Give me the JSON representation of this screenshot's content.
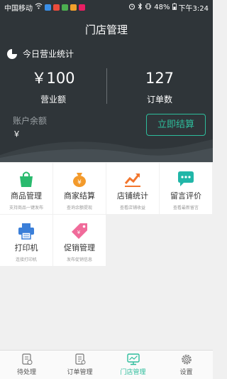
{
  "status_bar": {
    "carrier": "中国移动",
    "battery": "48%",
    "time": "下午3:24"
  },
  "header": {
    "title": "门店管理",
    "today_stats_label": "今日营业统计",
    "revenue_value": "￥100",
    "revenue_label": "营业额",
    "orders_value": "127",
    "orders_label": "订单数",
    "balance_label": "账户余额",
    "balance_value": "￥",
    "settle_button": "立即结算"
  },
  "tiles": [
    {
      "title": "商品管理",
      "subtitle": "支持商品一键发布",
      "icon": "bag-icon"
    },
    {
      "title": "商家结算",
      "subtitle": "查询余额提现",
      "icon": "money-bag-icon"
    },
    {
      "title": "店铺统计",
      "subtitle": "查看店铺收益",
      "icon": "trend-chart-icon"
    },
    {
      "title": "留言评价",
      "subtitle": "查看最新留言",
      "icon": "chat-bubble-icon"
    },
    {
      "title": "打印机",
      "subtitle": "连接打印机",
      "icon": "printer-icon"
    },
    {
      "title": "促销管理",
      "subtitle": "发布促销信息",
      "icon": "tag-icon"
    }
  ],
  "nav": [
    {
      "label": "待处理",
      "icon": "pending-doc-icon"
    },
    {
      "label": "订单管理",
      "icon": "order-doc-icon"
    },
    {
      "label": "门店管理",
      "icon": "store-monitor-icon"
    },
    {
      "label": "设置",
      "icon": "gear-icon"
    }
  ],
  "colors": {
    "header_bg": "#2f3539",
    "accent": "#2ebd9c",
    "bag_green": "#2aba6e",
    "money_orange": "#f39a2b",
    "chart_orange": "#f2762e",
    "chat_teal": "#21b6a8",
    "printer_blue": "#3b7fd9",
    "tag_pink": "#f06b9a"
  }
}
